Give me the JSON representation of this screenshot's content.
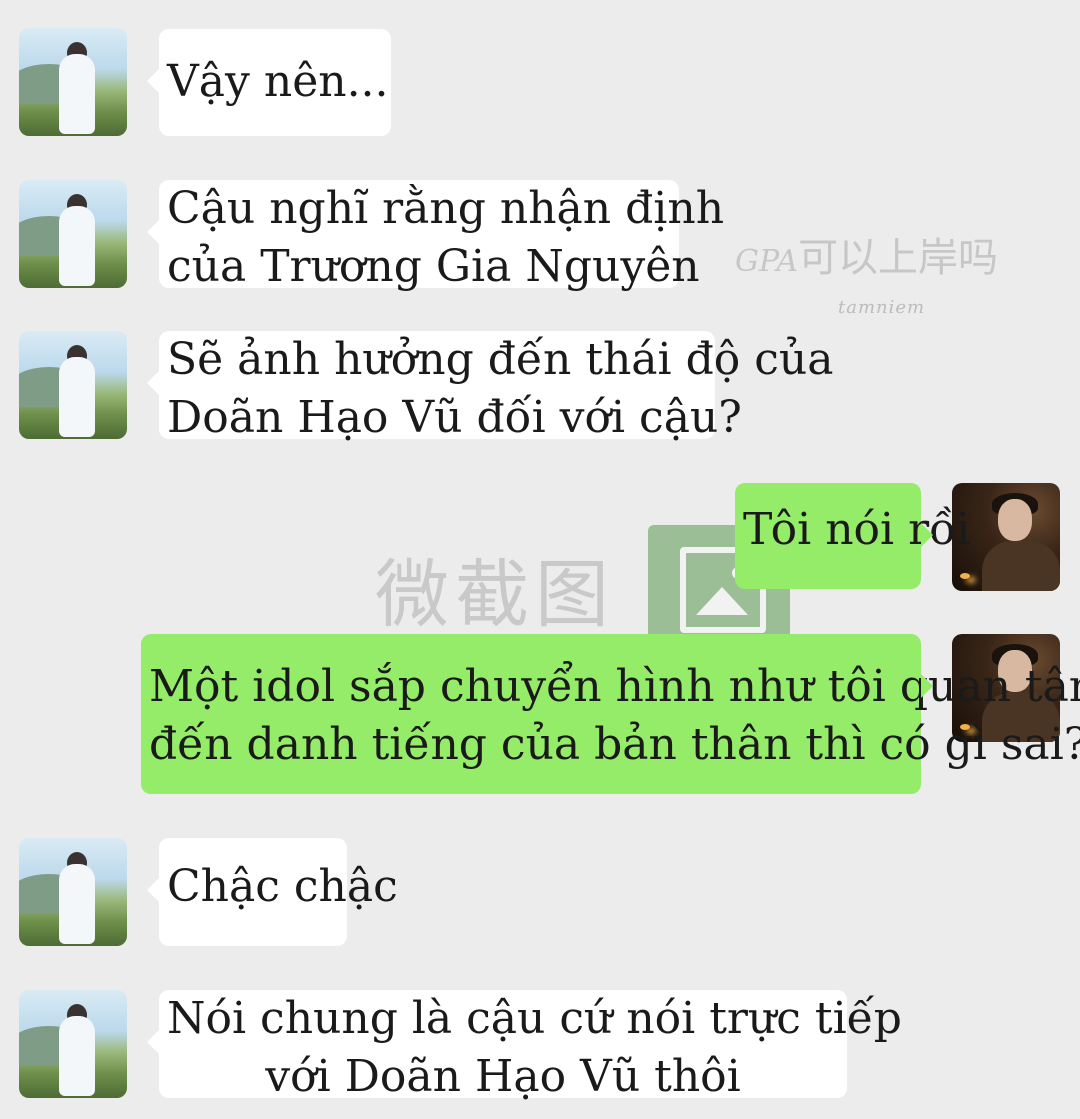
{
  "watermarks": {
    "app_name_cn": "微截图",
    "gpa_prefix": "GPA",
    "gpa_text": "可以上岸吗",
    "credit": "tamniem"
  },
  "messages": [
    {
      "sender": "other",
      "lines": [
        "Vậy nên..."
      ]
    },
    {
      "sender": "other",
      "lines": [
        "Cậu nghĩ rằng nhận định",
        "của Trương Gia Nguyên"
      ]
    },
    {
      "sender": "other",
      "lines": [
        "Sẽ ảnh hưởng đến thái độ của",
        "Doãn Hạo Vũ đối với cậu?"
      ]
    },
    {
      "sender": "self",
      "lines": [
        "Tôi nói rồi"
      ]
    },
    {
      "sender": "self",
      "lines": [
        "Một idol sắp chuyển hình như tôi quan tâm",
        "đến danh tiếng của bản thân thì có gì sai?"
      ]
    },
    {
      "sender": "other",
      "lines": [
        "Chậc chậc"
      ]
    },
    {
      "sender": "other",
      "lines": [
        "Nói chung là cậu cứ nói trực tiếp",
        "với Doãn Hạo Vũ thôi"
      ]
    }
  ]
}
